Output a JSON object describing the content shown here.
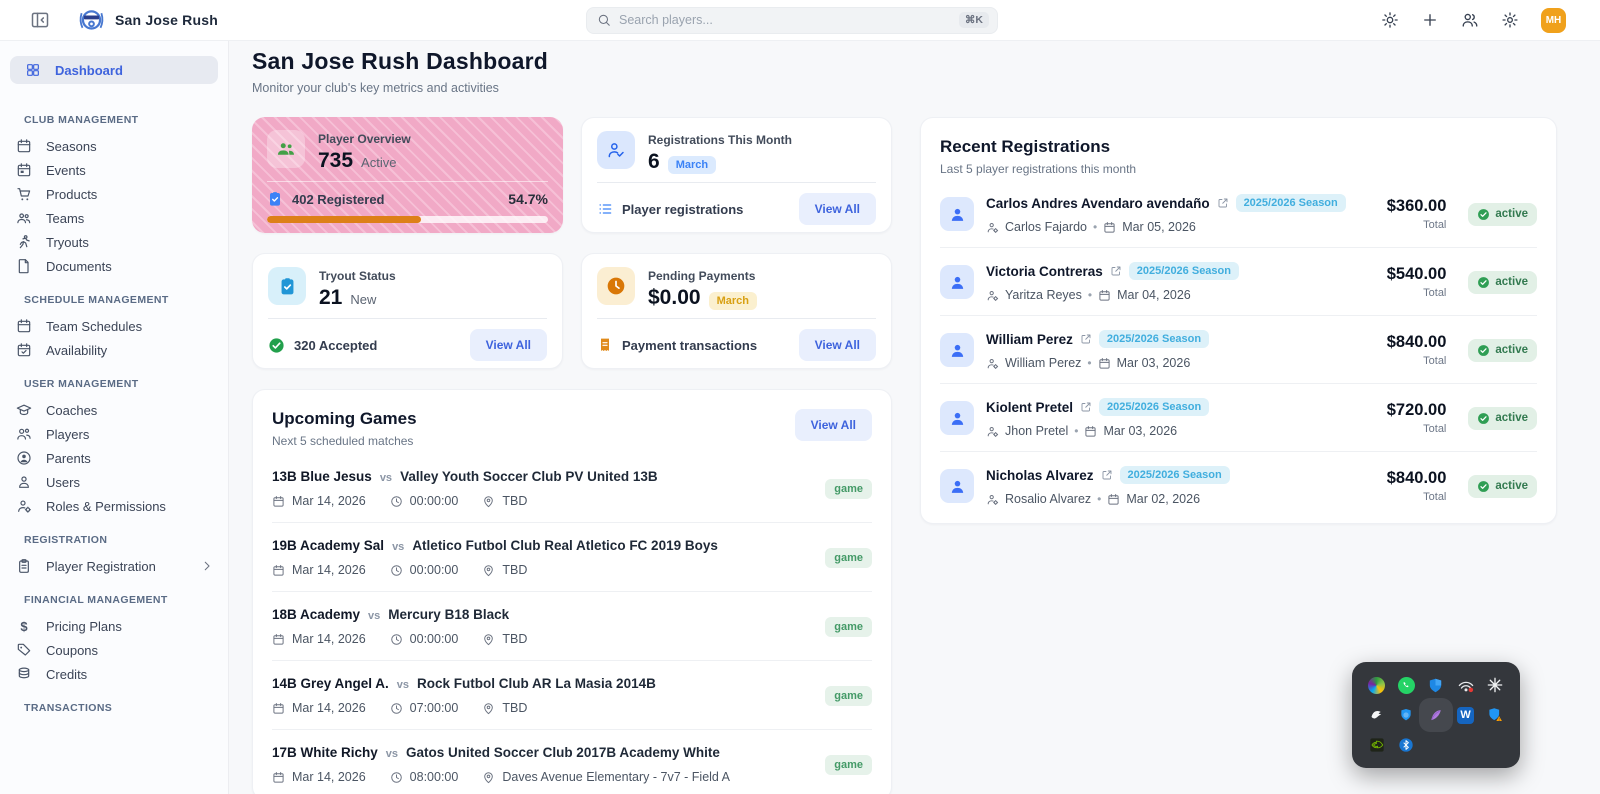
{
  "header": {
    "brand": "San Jose Rush",
    "search_placeholder": "Search players...",
    "search_shortcut": "⌘K",
    "avatar_initials": "MH"
  },
  "page": {
    "title": "San Jose Rush Dashboard",
    "subtitle": "Monitor your club's key metrics and activities"
  },
  "ui": {
    "view_all": "View All",
    "vs": "vs",
    "dot": "•"
  },
  "sidebar": {
    "dashboard_label": "Dashboard",
    "sections": [
      {
        "title": "CLUB MANAGEMENT",
        "items": [
          {
            "label": "Seasons"
          },
          {
            "label": "Events"
          },
          {
            "label": "Products"
          },
          {
            "label": "Teams"
          },
          {
            "label": "Tryouts"
          },
          {
            "label": "Documents"
          }
        ]
      },
      {
        "title": "SCHEDULE MANAGEMENT",
        "items": [
          {
            "label": "Team Schedules"
          },
          {
            "label": "Availability"
          }
        ]
      },
      {
        "title": "USER MANAGEMENT",
        "items": [
          {
            "label": "Coaches"
          },
          {
            "label": "Players"
          },
          {
            "label": "Parents"
          },
          {
            "label": "Users"
          },
          {
            "label": "Roles & Permissions"
          }
        ]
      },
      {
        "title": "REGISTRATION",
        "items": [
          {
            "label": "Player Registration"
          }
        ]
      },
      {
        "title": "FINANCIAL MANAGEMENT",
        "items": [
          {
            "label": "Pricing Plans"
          },
          {
            "label": "Coupons"
          },
          {
            "label": "Credits"
          }
        ]
      },
      {
        "title": "TRANSACTIONS",
        "items": []
      }
    ]
  },
  "stats": {
    "player_overview": {
      "title": "Player Overview",
      "value": "735",
      "unit": "Active",
      "registered": "402 Registered",
      "percent": "54.7%",
      "progress_style": "width:54.7%"
    },
    "registrations": {
      "title": "Registrations This Month",
      "value": "6",
      "badge": "March",
      "footer": "Player registrations"
    },
    "tryout": {
      "title": "Tryout Status",
      "value": "21",
      "unit": "New",
      "footer": "320 Accepted"
    },
    "pending": {
      "title": "Pending Payments",
      "value": "$0.00",
      "badge": "March",
      "footer": "Payment transactions"
    }
  },
  "upcoming": {
    "title": "Upcoming Games",
    "subtitle": "Next 5 scheduled matches",
    "badge": "game",
    "games": [
      {
        "home": "13B Blue Jesus",
        "away": "Valley Youth Soccer Club PV United 13B",
        "date": "Mar 14, 2026",
        "time": "00:00:00",
        "location": "TBD"
      },
      {
        "home": "19B Academy Sal",
        "away": "Atletico Futbol Club Real Atletico FC 2019 Boys",
        "date": "Mar 14, 2026",
        "time": "00:00:00",
        "location": "TBD"
      },
      {
        "home": "18B Academy",
        "away": "Mercury B18 Black",
        "date": "Mar 14, 2026",
        "time": "00:00:00",
        "location": "TBD"
      },
      {
        "home": "14B Grey Angel A.",
        "away": "Rock Futbol Club AR La Masia 2014B",
        "date": "Mar 14, 2026",
        "time": "07:00:00",
        "location": "TBD"
      },
      {
        "home": "17B White Richy",
        "away": "Gatos United Soccer Club 2017B Academy White",
        "date": "Mar 14, 2026",
        "time": "08:00:00",
        "location": "Daves Avenue Elementary - 7v7 - Field A"
      }
    ]
  },
  "recent": {
    "title": "Recent Registrations",
    "subtitle": "Last 5 player registrations this month",
    "total_label": "Total",
    "status_label": "active",
    "rows": [
      {
        "name": "Carlos Andres Avendaro avendaño",
        "season": "2025/2026 Season",
        "parent": "Carlos Fajardo",
        "date": "Mar 05, 2026",
        "amount": "$360.00"
      },
      {
        "name": "Victoria Contreras",
        "season": "2025/2026 Season",
        "parent": "Yaritza Reyes",
        "date": "Mar 04, 2026",
        "amount": "$540.00"
      },
      {
        "name": "William Perez",
        "season": "2025/2026 Season",
        "parent": "William Perez",
        "date": "Mar 03, 2026",
        "amount": "$840.00"
      },
      {
        "name": "Kiolent Pretel",
        "season": "2025/2026 Season",
        "parent": "Jhon Pretel",
        "date": "Mar 03, 2026",
        "amount": "$720.00"
      },
      {
        "name": "Nicholas Alvarez",
        "season": "2025/2026 Season",
        "parent": "Rosalio Alvarez",
        "date": "Mar 02, 2026",
        "amount": "$840.00"
      }
    ]
  },
  "dock": {
    "apps": [
      "internet-download-manager",
      "whatsapp",
      "windows-security",
      "mobile-hotspot",
      "snowflake",
      "hand",
      "blue-shield",
      "feather",
      "wondershare-w",
      "shield-warning",
      "nvidia",
      "bluetooth"
    ],
    "highlighted": "feather"
  },
  "colors": {
    "accent_blue": "#3e63dd",
    "pink_card": "#f1a9c6",
    "progress_orange": "#dd8018",
    "badge_green": "#449a67",
    "avatar_amber": "#f0a11c"
  }
}
